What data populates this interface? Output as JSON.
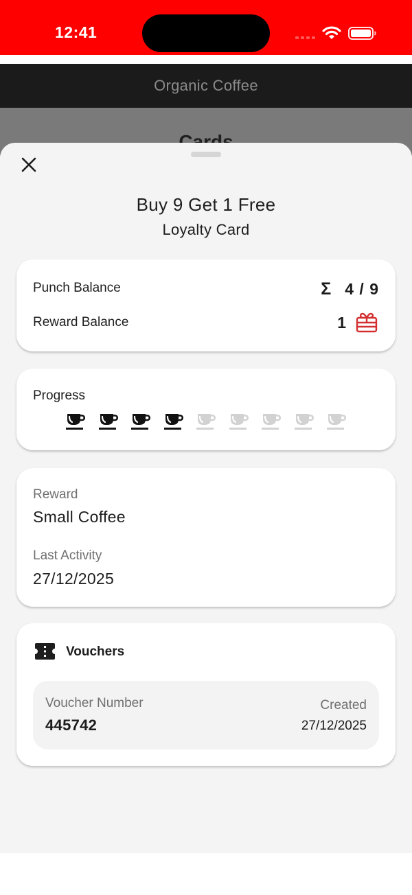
{
  "status_bar": {
    "time": "12:41",
    "background": "#ff0000"
  },
  "app": {
    "title": "Organic Coffee",
    "page_title": "Cards"
  },
  "sheet": {
    "title": "Buy 9 Get 1 Free",
    "subtitle": "Loyalty Card",
    "close_icon": "close-icon"
  },
  "balances": {
    "punch_label": "Punch Balance",
    "punch_icon": "sigma-icon",
    "punch_value": "4 / 9",
    "reward_label": "Reward Balance",
    "reward_value": "1",
    "reward_icon": "gift-icon",
    "reward_icon_color": "#d32f2f"
  },
  "progress": {
    "label": "Progress",
    "filled": 4,
    "total": 9,
    "filled_color": "#111111",
    "empty_color": "#d2d2d2"
  },
  "reward": {
    "label": "Reward",
    "value": "Small Coffee",
    "last_activity_label": "Last Activity",
    "last_activity_value": "27/12/2025"
  },
  "vouchers": {
    "label": "Vouchers",
    "icon": "ticket-icon",
    "items": [
      {
        "number_label": "Voucher Number",
        "number": "445742",
        "created_label": "Created",
        "created": "27/12/2025"
      }
    ]
  }
}
